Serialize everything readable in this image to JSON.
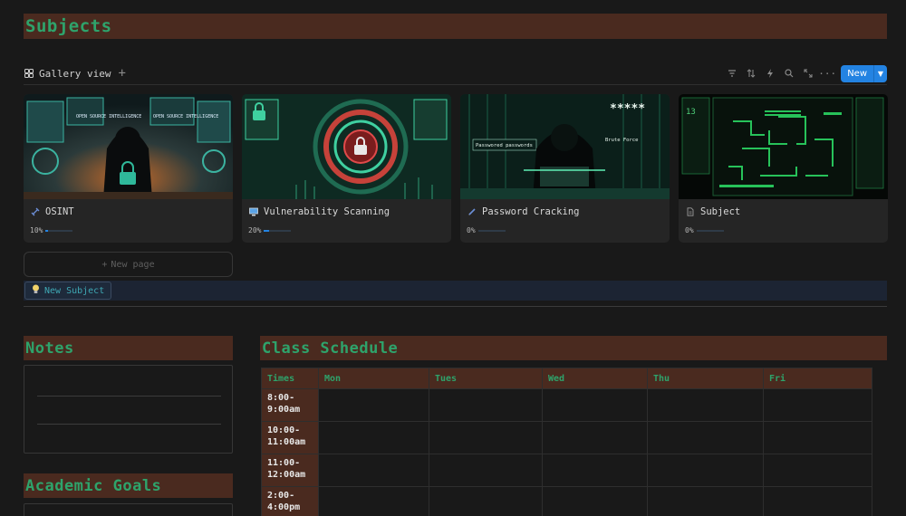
{
  "subjects": {
    "title": "Subjects",
    "view_tab": {
      "label": "Gallery view",
      "icon": "gallery-grid-icon"
    },
    "toolbar": {
      "tools": [
        "filter-icon",
        "sort-icon",
        "lightning-icon",
        "search-icon",
        "expand-icon",
        "more-icon"
      ],
      "new_label": "New"
    },
    "cards": [
      {
        "title": "OSINT",
        "icon": "satellite-icon",
        "progress_label": "10%",
        "progress": 0.1
      },
      {
        "title": "Vulnerability Scanning",
        "icon": "computer-icon",
        "progress_label": "20%",
        "progress": 0.2
      },
      {
        "title": "Password Cracking",
        "icon": "pencil-icon",
        "progress_label": "0%",
        "progress": 0.0
      },
      {
        "title": "Subject",
        "icon": "page-icon",
        "progress_label": "0%",
        "progress": 0.0
      }
    ],
    "cover_texts": {
      "osint_a": "OPEN SOURCE INTELLIGENCE",
      "osint_b": "OPEN SOURCE INTELLIGENCE",
      "pw_a": "Passwored passwords",
      "pw_b": "Brute Force",
      "pw_c": "*****",
      "subj_a": "13"
    },
    "new_page_label": "New page",
    "new_subject_label": "New Subject"
  },
  "notes": {
    "title": "Notes"
  },
  "goals": {
    "title": "Academic Goals"
  },
  "schedule": {
    "title": "Class Schedule",
    "columns": [
      "Times",
      "Mon",
      "Tues",
      "Wed",
      "Thu",
      "Fri"
    ],
    "rows": [
      {
        "time": "8:00-9:00am"
      },
      {
        "time": "10:00-11:00am"
      },
      {
        "time": "11:00-12:00am"
      },
      {
        "time": "2:00-4:00pm"
      }
    ]
  },
  "colors": {
    "header_bg": "#4a2a1f",
    "header_text": "#2ea36b",
    "accent_blue": "#2383e2",
    "background": "#191919"
  }
}
